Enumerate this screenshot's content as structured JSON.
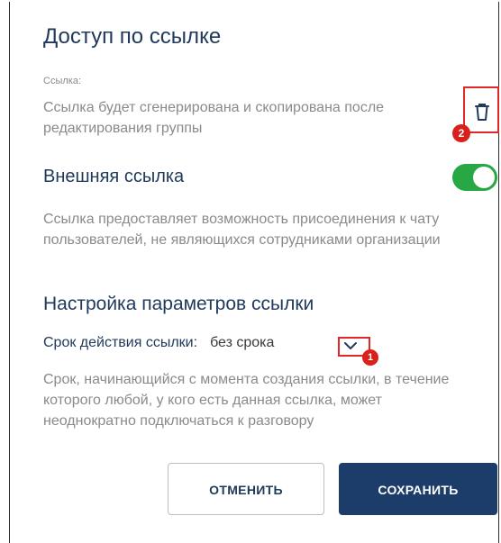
{
  "dialog": {
    "title": "Доступ по ссылке",
    "link_label": "Ссылка:",
    "link_text": "Ссылка будет сгенерирована и скопирована после редактирования группы",
    "external_title": "Внешняя ссылка",
    "external_enabled": true,
    "external_desc": "Ссылка предоставляет возможность присоединения к чату пользователей, не являющихся сотрудниками организации",
    "settings_title": "Настройка параметров ссылки",
    "expiry_label": "Срок действия ссылки:",
    "expiry_value": "без срока",
    "expiry_desc": "Срок, начинающийся с момента создания ссылки, в течение которого любой, у кого есть данная ссылка, может неоднократно подключаться к разговору"
  },
  "annotations": {
    "badge1": "1",
    "badge2": "2"
  },
  "buttons": {
    "cancel": "ОТМЕНИТЬ",
    "save": "СОХРАНИТЬ"
  },
  "icons": {
    "delete": "trash-icon",
    "dropdown": "chevron-down-icon"
  },
  "colors": {
    "accent": "#1c3c6a",
    "toggle_on": "#28a745",
    "highlight": "#e32626",
    "heading": "#203a5c"
  }
}
